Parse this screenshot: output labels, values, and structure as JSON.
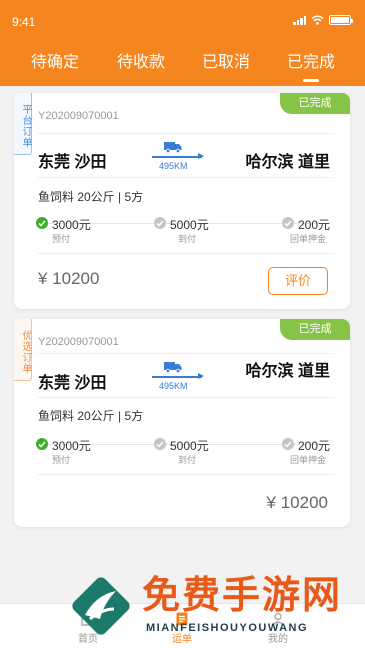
{
  "status_bar": {
    "time": "9:41"
  },
  "tabs": [
    {
      "label": "待确定",
      "active": false
    },
    {
      "label": "待收款",
      "active": false
    },
    {
      "label": "已取消",
      "active": false
    },
    {
      "label": "已完成",
      "active": true
    }
  ],
  "orders": [
    {
      "type_label": "平台订单",
      "status": "已完成",
      "order_no": "Y202009070001",
      "from": "东莞 沙田",
      "to": "哈尔滨 道里",
      "distance": "495KM",
      "cargo": "鱼饲料  20公斤 | 5方",
      "payments": [
        {
          "amount": "3000元",
          "label": "预付",
          "done": true
        },
        {
          "amount": "5000元",
          "label": "到付",
          "done": false
        },
        {
          "amount": "200元",
          "label": "回单押金",
          "done": false
        }
      ],
      "price": "¥ 10200",
      "action": "评价"
    },
    {
      "type_label": "优选订单",
      "status": "已完成",
      "order_no": "Y202009070001",
      "from": "东莞 沙田",
      "to": "哈尔滨 道里",
      "distance": "495KM",
      "cargo": "鱼饲料  20公斤 | 5方",
      "payments": [
        {
          "amount": "3000元",
          "label": "预付",
          "done": true
        },
        {
          "amount": "5000元",
          "label": "到付",
          "done": false
        },
        {
          "amount": "200元",
          "label": "回单押金",
          "done": false
        }
      ],
      "price": "¥ 10200"
    }
  ],
  "bottom_nav": [
    {
      "label": "首页",
      "icon": "home-icon",
      "active": false
    },
    {
      "label": "运单",
      "icon": "waybill-icon",
      "active": true
    },
    {
      "label": "我的",
      "icon": "profile-icon",
      "active": false
    }
  ],
  "watermark": {
    "title": "免费手游网",
    "subtitle": "MIANFEISHOUYOUWANG"
  },
  "colors": {
    "brand": "#f5861f",
    "status_done": "#86c448",
    "route": "#3a7bd5",
    "check": "#3fae2a"
  }
}
